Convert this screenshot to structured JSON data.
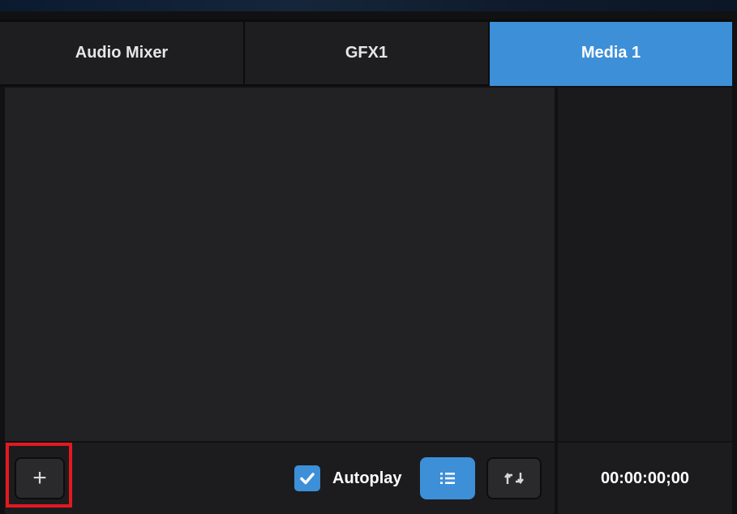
{
  "tabs": [
    {
      "label": "Audio Mixer",
      "active": false
    },
    {
      "label": "GFX1",
      "active": false
    },
    {
      "label": "Media 1",
      "active": true
    }
  ],
  "toolbar": {
    "add_label": "+",
    "autoplay_label": "Autoplay",
    "autoplay_checked": true,
    "list_icon": "list-icon",
    "loop_icon": "loop-icon"
  },
  "timecode": "00:00:00;00",
  "colors": {
    "accent": "#3d8fd8",
    "highlight": "#e3191f",
    "panel_bg": "#222224"
  }
}
